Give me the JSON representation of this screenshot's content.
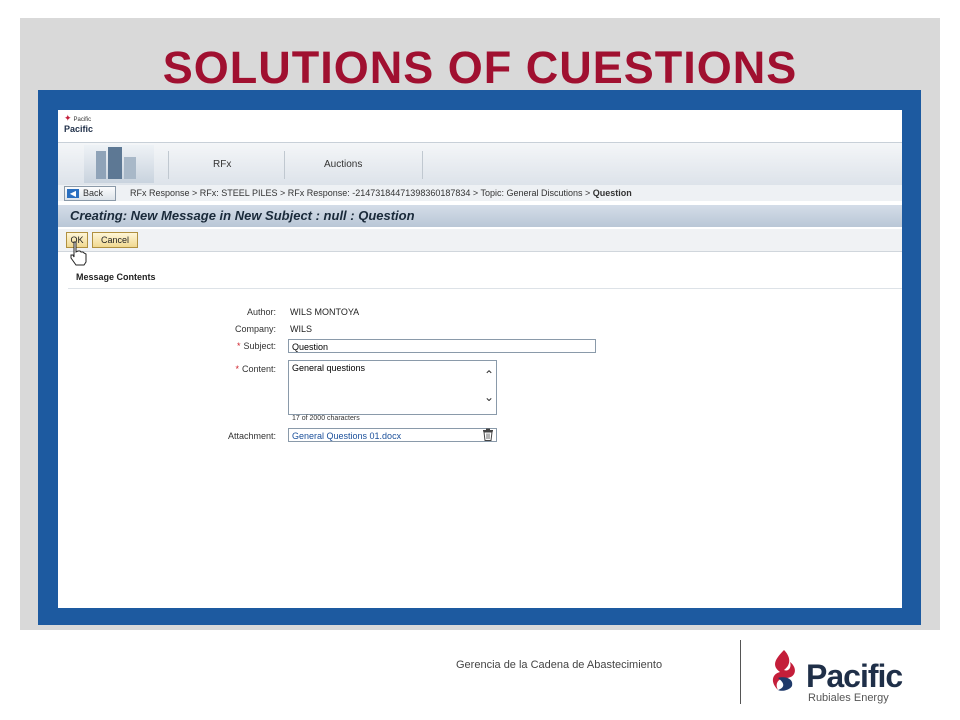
{
  "slide": {
    "title": "SOLUTIONS OF CUESTIONS",
    "footer_text": "Gerencia de la Cadena de Abastecimiento",
    "brand_name": "Pacific",
    "brand_subtitle": "Rubiales Energy",
    "title_color": "#a01030",
    "frame_color": "#1d5aa0"
  },
  "app": {
    "logo_text_small": "Pacific",
    "logo_text": "Pacific",
    "tabs": [
      {
        "label": "RFx"
      },
      {
        "label": "Auctions"
      }
    ],
    "back_label": "Back",
    "breadcrumb": "RFx Response > RFx: STEEL PILES > RFx Response: -2147318447139836018783​4 > Topic: General Discutions > ",
    "breadcrumb_current": "Question",
    "header_title": "Creating: New Message in New Subject : null : Question",
    "ok_label": "OK",
    "cancel_label": "Cancel",
    "section_title": "Message Contents",
    "form": {
      "author_label": "Author:",
      "author_value": "WILS MONTOYA",
      "company_label": "Company:",
      "company_value": "WILS",
      "subject_label": "Subject:",
      "subject_value": "Question",
      "content_label": "Content:",
      "content_value": "General questions",
      "char_count": "17 of 2000 characters",
      "attachment_label": "Attachment:",
      "attachment_value": "General Questions 01.docx",
      "required_mark": "*"
    }
  }
}
